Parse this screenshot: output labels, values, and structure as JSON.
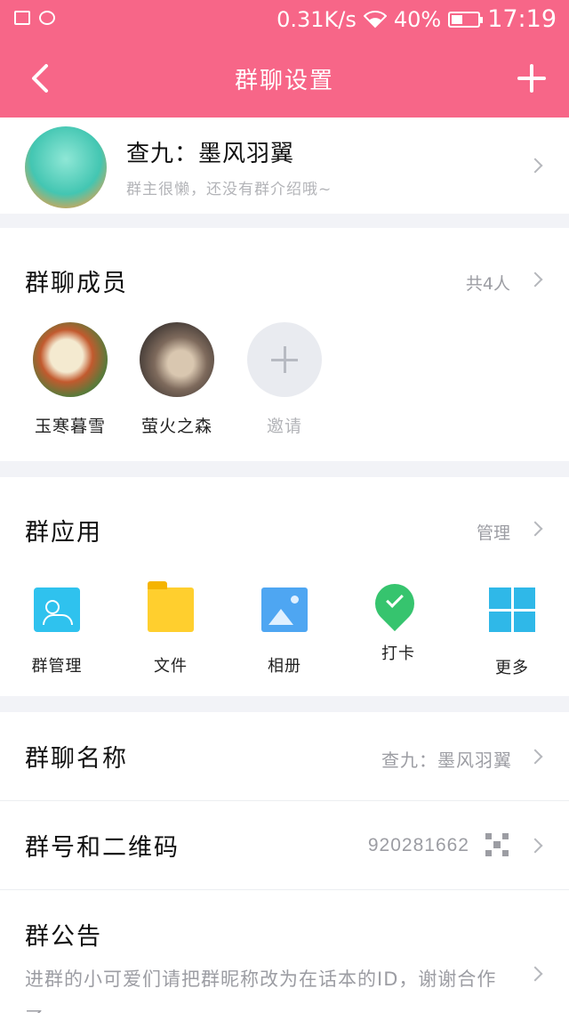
{
  "status_bar": {
    "network_speed": "0.31K/s",
    "battery": "40%",
    "time": "17:19"
  },
  "nav": {
    "title": "群聊设置"
  },
  "group": {
    "name": "查九：墨风羽翼",
    "description": "群主很懒，还没有群介绍哦~"
  },
  "members": {
    "title": "群聊成员",
    "count": "共4人",
    "items": [
      {
        "name": "玉寒暮雪"
      },
      {
        "name": "萤火之森"
      }
    ],
    "invite_label": "邀请"
  },
  "apps": {
    "title": "群应用",
    "manage_label": "管理",
    "items": [
      {
        "label": "群管理",
        "icon": "group-manage-icon"
      },
      {
        "label": "文件",
        "icon": "folder-icon"
      },
      {
        "label": "相册",
        "icon": "album-icon"
      },
      {
        "label": "打卡",
        "icon": "checkin-pin-icon"
      },
      {
        "label": "更多",
        "icon": "grid-more-icon"
      }
    ]
  },
  "group_name_row": {
    "label": "群聊名称",
    "value": "查九：墨风羽翼"
  },
  "group_id_row": {
    "label": "群号和二维码",
    "value": "920281662"
  },
  "notice_row": {
    "label": "群公告",
    "content": "进群的小可爱们请把群昵称改为在话本的ID，谢谢合作了"
  }
}
